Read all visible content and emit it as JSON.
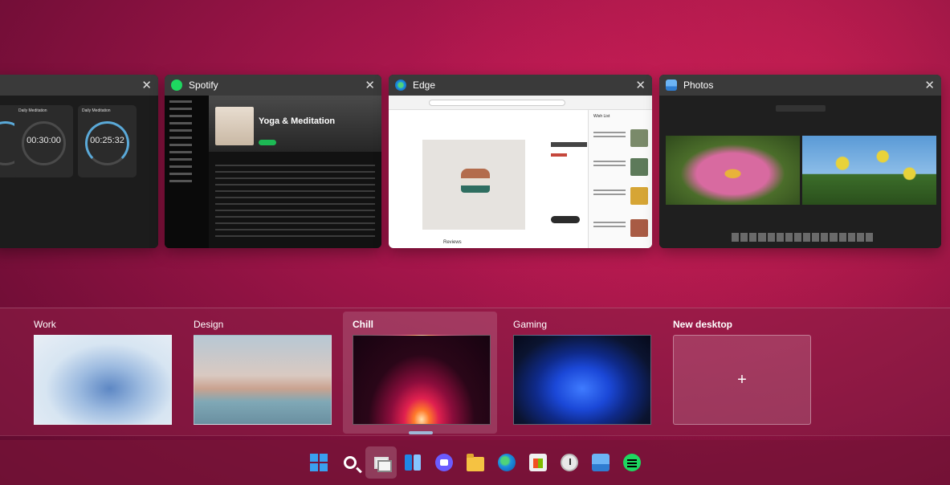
{
  "windows": {
    "clock": {
      "close": "✕",
      "timers": [
        {
          "label": "Daily Meditation",
          "time": "00:30:00"
        },
        {
          "label": "Daily Meditation",
          "time": "00:25:32"
        }
      ]
    },
    "spotify": {
      "title": "Spotify",
      "close": "✕",
      "playlist": "Yoga & Meditation"
    },
    "edge": {
      "title": "Edge",
      "close": "✕",
      "panel_title": "Wish List",
      "section": "Reviews"
    },
    "photos": {
      "title": "Photos",
      "close": "✕"
    }
  },
  "desktops": {
    "items": [
      {
        "label": "Work"
      },
      {
        "label": "Design"
      },
      {
        "label": "Chill"
      },
      {
        "label": "Gaming"
      }
    ],
    "new_label": "New desktop",
    "new_symbol": "+",
    "active": "Chill"
  },
  "taskbar": {
    "icons": [
      "windows-start-icon",
      "search-icon",
      "task-view-icon",
      "widgets-icon",
      "chat-icon",
      "file-explorer-icon",
      "edge-icon",
      "store-icon",
      "clock-icon",
      "photos-icon",
      "spotify-icon"
    ]
  },
  "colors": {
    "accent_blue": "#3aa0f0",
    "spotify_green": "#1db954",
    "clock_ring": "#5aa9d8"
  }
}
